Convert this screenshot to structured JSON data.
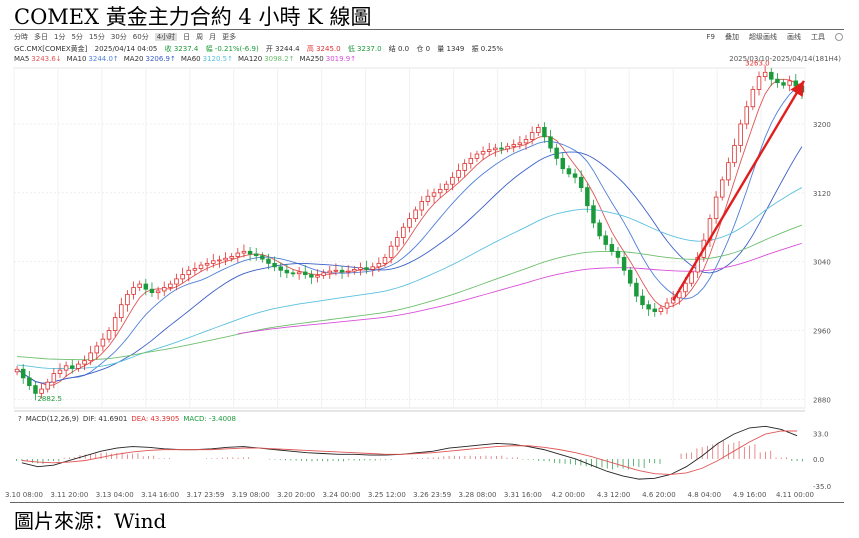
{
  "title": "COMEX 黃金主力合約 4 小時 K 線圖",
  "source": "圖片來源：Wind",
  "toolbar": {
    "periods": [
      "分時",
      "多日",
      "1分",
      "5分",
      "15分",
      "30分",
      "60分",
      "4小时",
      "日",
      "周",
      "月",
      "更多"
    ],
    "active_period": "4小时",
    "right": [
      "F9",
      "叠加",
      "超级画线",
      "画线",
      "工具"
    ]
  },
  "info": {
    "symbol": "GC.CMX[COMEX黄金]",
    "datetime": "2025/04/14 04:05",
    "close": "收 3237.4",
    "change": "幅 -0.21%(-6.9)",
    "open": "开 3244.4",
    "high": "高 3245.0",
    "low": "低 3237.0",
    "settle": "结 0.0",
    "oi": "仓 0",
    "volume": "量 1349",
    "amplitude": "振 0.25%"
  },
  "ma_legend": [
    {
      "label": "MA5",
      "value": "3243.6↓",
      "color": "#e05555"
    },
    {
      "label": "MA10",
      "value": "3244.0↑",
      "color": "#4f7fd9"
    },
    {
      "label": "MA20",
      "value": "3206.9↑",
      "color": "#3a5fc8"
    },
    {
      "label": "MA60",
      "value": "3120.5↑",
      "color": "#5bc0de"
    },
    {
      "label": "MA120",
      "value": "3098.2↑",
      "color": "#6dbf6d"
    },
    {
      "label": "MA250",
      "value": "3019.9↑",
      "color": "#d84fd8"
    }
  ],
  "range_label": "2025/03/10-2025/04/14(181H4)",
  "macd_legend": {
    "question": "?",
    "label": "MACD(12,26,9)",
    "dif": "DIF: 41.6901",
    "dea": "DEA: 43.3905",
    "macd": "MACD: -3.4008"
  },
  "colors": {
    "up": "#e03030",
    "down": "#1a9a3a",
    "arrow": "#e01e1e"
  },
  "chart_data": {
    "type": "candlestick",
    "title": "COMEX 黃金主力合約 4 小時 K 線圖",
    "y_ticks": [
      2880,
      2960,
      3040,
      3120,
      3200
    ],
    "ylim": [
      2870,
      3265
    ],
    "x_ticks": [
      "3.10 08:00",
      "3.11 20:00",
      "3.13 04:00",
      "3.14 16:00",
      "3.17 23:59",
      "3.19 08:00",
      "3.20 20:00",
      "3.24 00:00",
      "3.25 12:00",
      "3.26 23:59",
      "3.28 08:00",
      "3.31 16:00",
      "4.2 00:00",
      "4.3 12:00",
      "4.6 20:00",
      "4.8 04:00",
      "4.9 16:00",
      "4.11 00:00"
    ],
    "annotations": [
      {
        "label": "2882.5",
        "value": 2882.5
      },
      {
        "label": "3263.0",
        "value": 3263.0
      }
    ],
    "close": [
      2915,
      2905,
      2896,
      2887,
      2892,
      2900,
      2910,
      2914,
      2919,
      2916,
      2921,
      2925,
      2934,
      2942,
      2950,
      2960,
      2975,
      2990,
      3002,
      3010,
      3014,
      3008,
      3004,
      3006,
      3010,
      3014,
      3020,
      3025,
      3030,
      3032,
      3036,
      3038,
      3041,
      3042,
      3044,
      3046,
      3050,
      3052,
      3049,
      3047,
      3043,
      3038,
      3034,
      3030,
      3027,
      3026,
      3028,
      3025,
      3022,
      3024,
      3027,
      3029,
      3030,
      3028,
      3029,
      3031,
      3033,
      3031,
      3034,
      3038,
      3045,
      3058,
      3068,
      3080,
      3090,
      3100,
      3110,
      3116,
      3120,
      3124,
      3130,
      3138,
      3146,
      3154,
      3160,
      3165,
      3168,
      3170,
      3172,
      3171,
      3174,
      3176,
      3178,
      3182,
      3190,
      3196,
      3185,
      3172,
      3160,
      3148,
      3142,
      3138,
      3126,
      3105,
      3085,
      3070,
      3060,
      3052,
      3045,
      3030,
      3015,
      3000,
      2990,
      2985,
      2982,
      2986,
      2992,
      2998,
      3005,
      3015,
      3028,
      3045,
      3065,
      3090,
      3115,
      3135,
      3155,
      3175,
      3200,
      3220,
      3240,
      3255,
      3260,
      3252,
      3248,
      3245,
      3250,
      3244,
      3237
    ],
    "macd": {
      "y_ticks": [
        33.0,
        0.0,
        -35.0
      ],
      "dif": [
        -5,
        -10,
        -8,
        -2,
        4,
        10,
        14,
        16,
        15,
        13,
        12,
        12,
        13,
        15,
        16,
        14,
        12,
        10,
        8,
        7,
        6,
        6,
        5,
        5,
        6,
        8,
        10,
        14,
        16,
        18,
        20,
        19,
        16,
        12,
        6,
        0,
        -8,
        -16,
        -22,
        -26,
        -25,
        -20,
        -10,
        4,
        20,
        32,
        40,
        42,
        38,
        30
      ],
      "dea": [
        -2,
        -4,
        -5,
        -4,
        -2,
        2,
        6,
        9,
        11,
        12,
        12,
        12,
        12,
        13,
        14,
        14,
        13,
        12,
        11,
        10,
        9,
        8,
        7,
        6,
        6,
        7,
        8,
        10,
        12,
        14,
        16,
        17,
        17,
        15,
        12,
        8,
        3,
        -3,
        -9,
        -15,
        -19,
        -20,
        -18,
        -12,
        -2,
        10,
        22,
        32,
        36,
        36
      ],
      "hist": [
        -3,
        -6,
        -3,
        2,
        6,
        8,
        8,
        7,
        4,
        1,
        0,
        0,
        1,
        2,
        2,
        0,
        -1,
        -2,
        -3,
        -3,
        -3,
        -2,
        -2,
        -1,
        0,
        1,
        2,
        4,
        4,
        4,
        4,
        2,
        -1,
        -3,
        -6,
        -8,
        -11,
        -13,
        -13,
        -11,
        -6,
        0,
        8,
        16,
        22,
        22,
        18,
        10,
        2,
        -3
      ]
    }
  }
}
